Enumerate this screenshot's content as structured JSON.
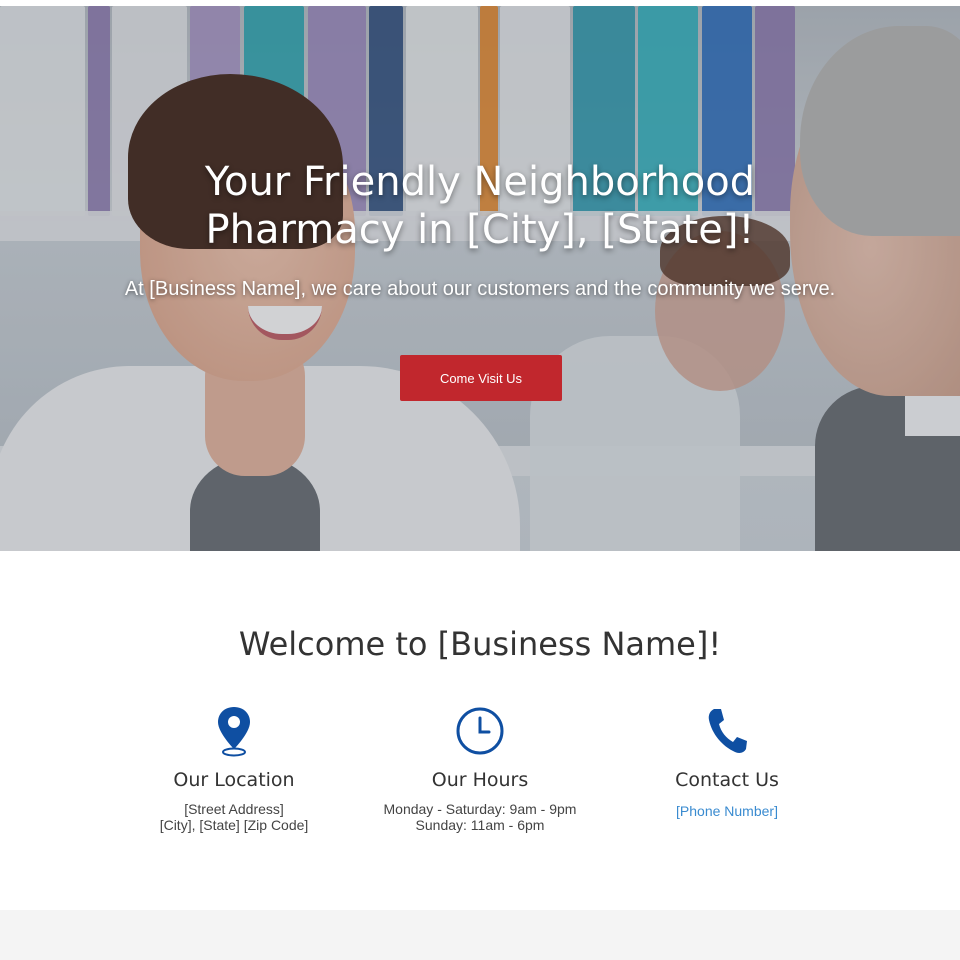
{
  "hero": {
    "title_line1": "Your Friendly Neighborhood",
    "title_line2": "Pharmacy in [City], [State]!",
    "subtitle": "At [Business Name], we care about our customers and the community we serve.",
    "cta_label": "Come Visit Us"
  },
  "welcome": {
    "title": "Welcome to [Business Name]!"
  },
  "features": [
    {
      "icon": "map-pin-icon",
      "heading": "Our Location",
      "lines": [
        "[Street Address]",
        "[City], [State] [Zip Code]"
      ]
    },
    {
      "icon": "clock-icon",
      "heading": "Our Hours",
      "lines": [
        "Monday - Saturday: 9am - 9pm",
        "Sunday: 11am - 6pm"
      ]
    },
    {
      "icon": "phone-icon",
      "heading": "Contact Us",
      "link": "[Phone Number]"
    }
  ],
  "colors": {
    "accent_red": "#c1272d",
    "icon_blue": "#0f4fa2",
    "link_blue": "#3a8bd0",
    "footer_gray": "#f4f4f4"
  }
}
